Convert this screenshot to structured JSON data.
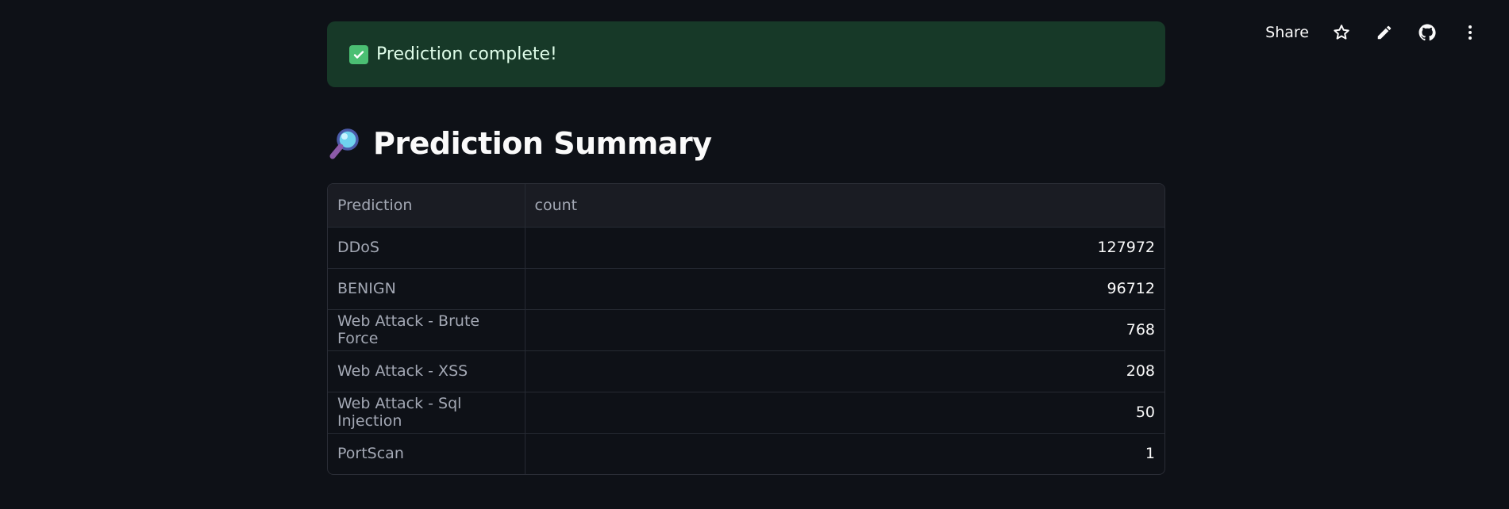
{
  "toolbar": {
    "share_label": "Share",
    "icons": [
      "star-icon",
      "pencil-icon",
      "github-icon",
      "more-vertical-icon"
    ]
  },
  "alert": {
    "icon": "check-icon",
    "text": "Prediction complete!",
    "background": "#173928",
    "text_color": "#dffde9"
  },
  "heading": {
    "icon": "magnifier-icon",
    "text": "Prediction Summary"
  },
  "table": {
    "columns": [
      "Prediction",
      "count"
    ],
    "rows": [
      [
        "DDoS",
        "127972"
      ],
      [
        "BENIGN",
        "96712"
      ],
      [
        "Web Attack - Brute Force",
        "768"
      ],
      [
        "Web Attack - XSS",
        "208"
      ],
      [
        "Web Attack - Sql Injection",
        "50"
      ],
      [
        "PortScan",
        "1"
      ]
    ]
  },
  "colors": {
    "background": "#0e1117",
    "table_header": "#1a1c23",
    "border": "#262a33"
  }
}
